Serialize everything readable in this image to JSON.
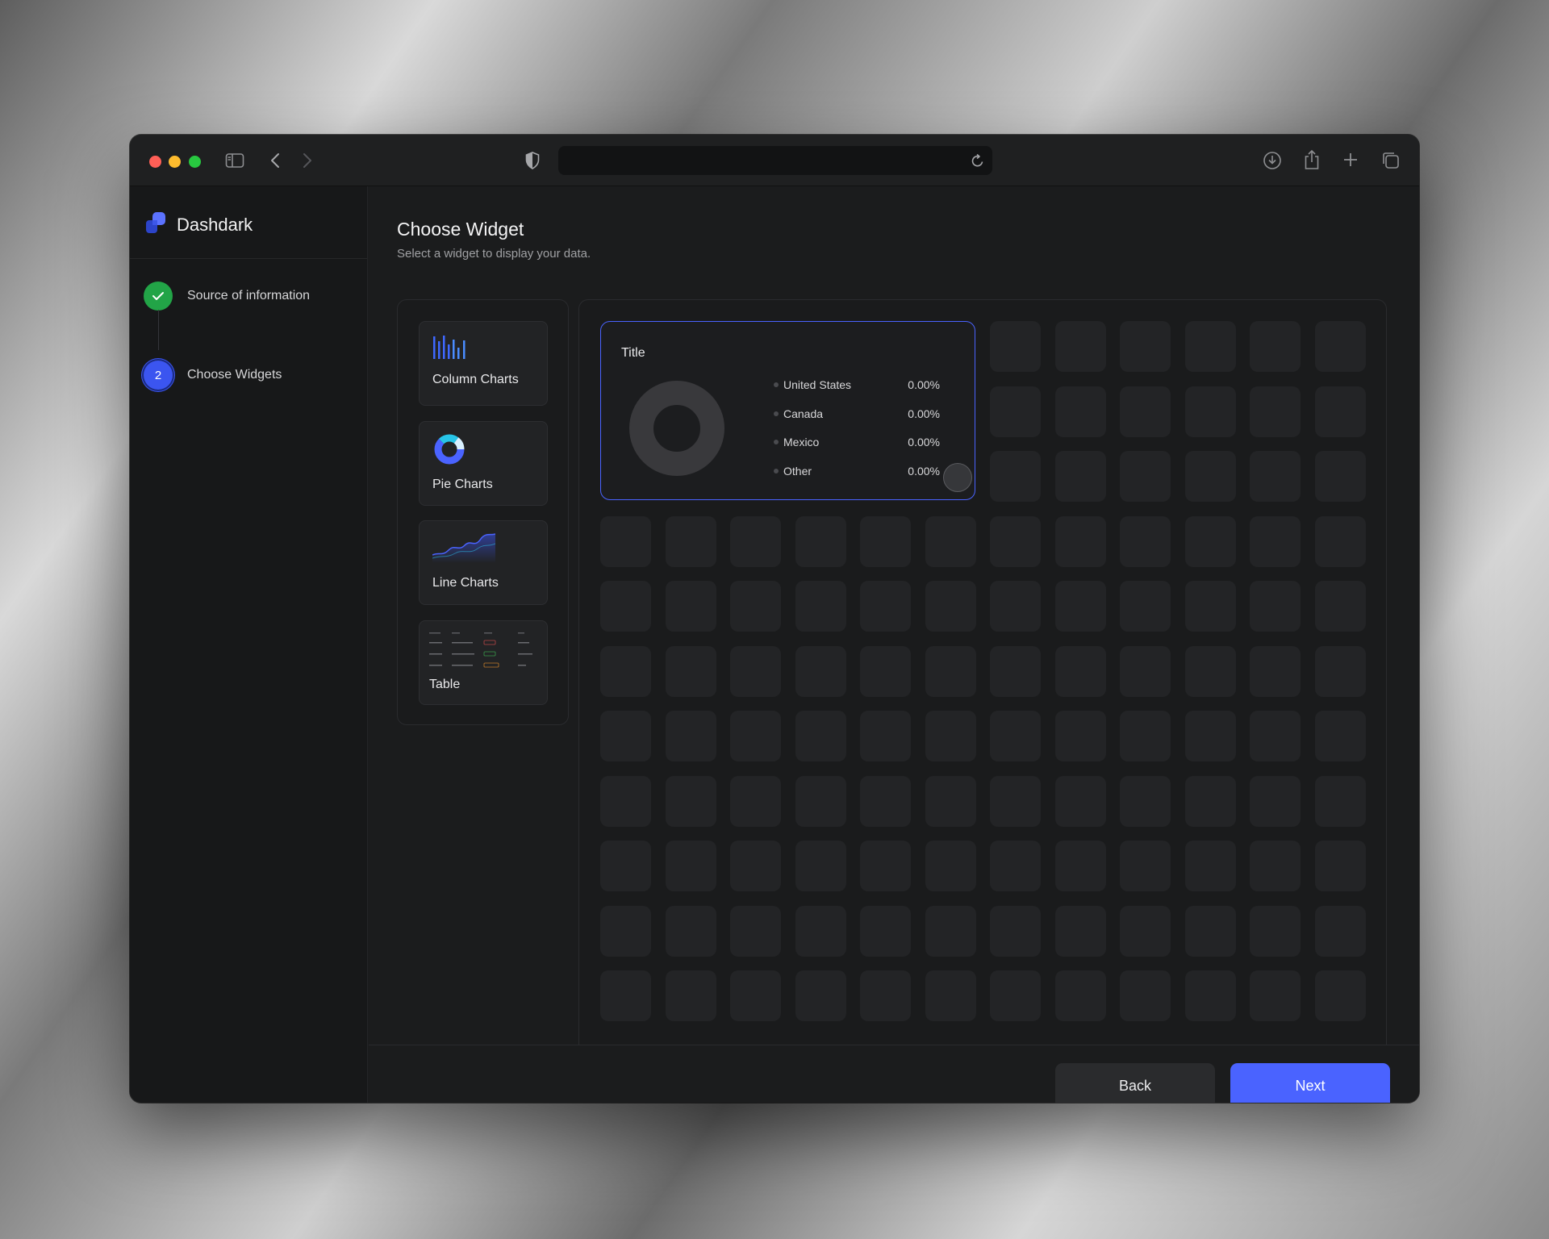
{
  "app": {
    "brand": "Dashdark",
    "accent_color": "#4a63ff",
    "success_color": "#22a447"
  },
  "titlebar": {
    "traffic_lights": [
      "#ff5f57",
      "#febc2e",
      "#28c840"
    ],
    "icons": [
      "sidebar-toggle-icon",
      "back-arrow-icon",
      "forward-arrow-icon",
      "privacy-shield-icon",
      "reload-icon",
      "download-icon",
      "share-icon",
      "new-tab-icon",
      "tab-overview-icon"
    ],
    "url": ""
  },
  "steps": [
    {
      "label": "Source of information",
      "status": "done",
      "icon": "check-icon"
    },
    {
      "label": "Choose Widgets",
      "status": "current",
      "number": "2"
    }
  ],
  "page": {
    "title": "Choose Widget",
    "subtitle": "Select a widget to display your data."
  },
  "widget_types": [
    {
      "label": "Column Charts",
      "icon": "column-chart-icon"
    },
    {
      "label": "Pie Charts",
      "icon": "pie-chart-icon"
    },
    {
      "label": "Line Charts",
      "icon": "line-chart-icon"
    },
    {
      "label": "Table",
      "icon": "table-preview-icon"
    }
  ],
  "widget": {
    "title": "Title",
    "legend": [
      {
        "label": "United States",
        "value": "0.00%"
      },
      {
        "label": "Canada",
        "value": "0.00%"
      },
      {
        "label": "Mexico",
        "value": "0.00%"
      },
      {
        "label": "Other",
        "value": "0.00%"
      }
    ]
  },
  "grid": {
    "columns": 12,
    "rows": 11
  },
  "footer": {
    "back_label": "Back",
    "next_label": "Next"
  }
}
